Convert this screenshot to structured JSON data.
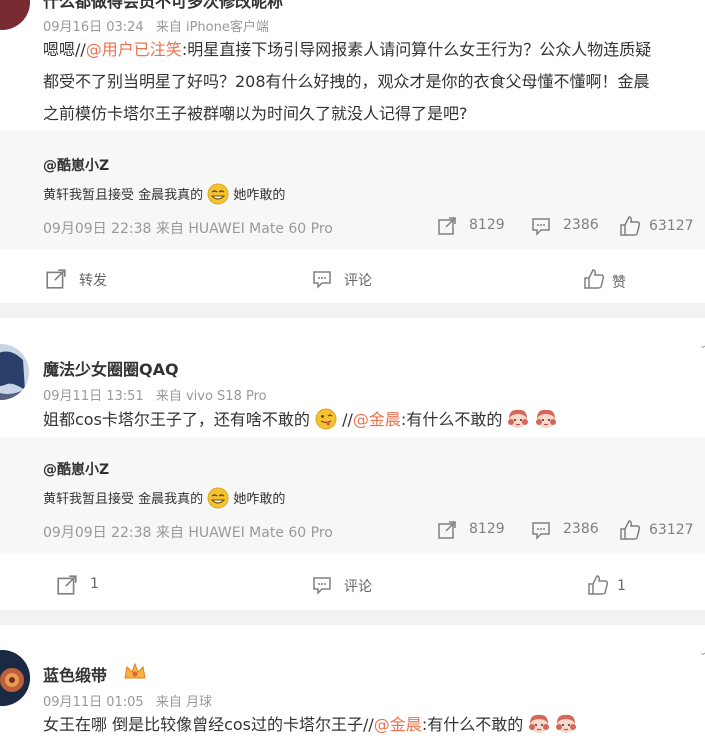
{
  "post1": {
    "partial_title": "什么都做得会员不可多次修改昵称",
    "meta_time": "09月16日 03:24",
    "meta_source": "来自 iPhone客户端",
    "line1_prefix": "嗯嗯//",
    "line1_mention": "@用户已注笑",
    "line1_rest": ":明星直接下场引导网报素人请问算什么女王行为？公众人物连质疑",
    "line2": "都受不了别当明星了好吗？208有什么好拽的，观众才是你的衣食父母懂不懂啊！金晨",
    "line3": "之前模仿卡塔尔王子被群嘲以为时间久了就没人记得了是吧?",
    "quote": {
      "author": "@酷崽小Z",
      "text_before": "黄轩我暂且接受 金晨我真的",
      "text_after": "她咋敢的",
      "meta": "09月09日 22:38 来自 HUAWEI Mate 60 Pro",
      "reposts": "8129",
      "comments": "2386",
      "likes": "63127"
    },
    "actions": {
      "repost": "转发",
      "comment": "评论",
      "like": "赞"
    }
  },
  "post2": {
    "author": "魔法少女圈圈QAQ",
    "meta_time": "09月11日 13:51",
    "meta_source": "来自 vivo S18 Pro",
    "text_before": "姐都cos卡塔尔王子了，还有啥不敢的",
    "text_sep": " //",
    "mention": "@金晨",
    "text_after": ":有什么不敢的",
    "quote": {
      "author": "@酷崽小Z",
      "text_before": "黄轩我暂且接受 金晨我真的",
      "text_after": "她咋敢的",
      "meta": "09月09日 22:38 来自 HUAWEI Mate 60 Pro",
      "reposts": "8129",
      "comments": "2386",
      "likes": "63127"
    },
    "actions": {
      "repost": "1",
      "comment": "评论",
      "like": "1"
    }
  },
  "post3": {
    "author": "蓝色缎带",
    "meta_time": "09月11日 01:05",
    "meta_source": "来自 月球",
    "text_before": "女王在哪 倒是比较像曾经cos过的卡塔尔王子//",
    "mention": "@金晨",
    "text_after": ":有什么不敢的"
  },
  "colors": {
    "mention": "#eb7350",
    "meta": "#999999",
    "quote_bg": "#f7f7f7",
    "page_bg": "#f2f2f2"
  },
  "icons": [
    "repost-icon",
    "comment-icon",
    "like-icon",
    "more-chevron-icon",
    "grin-emoji",
    "tongue-emoji",
    "girl-emoji",
    "crown-badge-icon"
  ]
}
